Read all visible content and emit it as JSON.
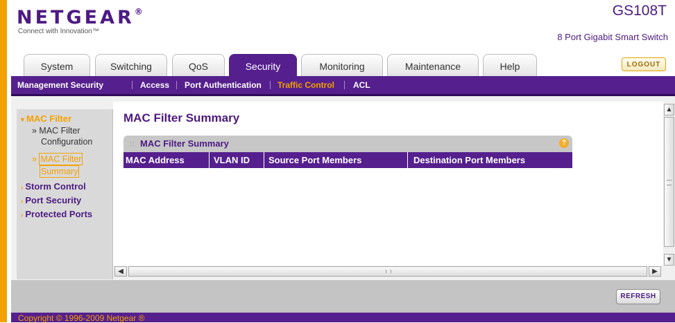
{
  "header": {
    "logo": "NETGEAR",
    "logo_mark": "®",
    "tagline": "Connect with Innovation™",
    "product": "GS108T",
    "subtitle": "8 Port Gigabit Smart Switch",
    "logout_label": "LOGOUT"
  },
  "tabs": [
    {
      "label": "System",
      "active": false
    },
    {
      "label": "Switching",
      "active": false
    },
    {
      "label": "QoS",
      "active": false
    },
    {
      "label": "Security",
      "active": true
    },
    {
      "label": "Monitoring",
      "active": false
    },
    {
      "label": "Maintenance",
      "active": false
    },
    {
      "label": "Help",
      "active": false
    }
  ],
  "subnav": [
    {
      "label": "Management Security",
      "active": false
    },
    {
      "label": "Access",
      "active": false
    },
    {
      "label": "Port Authentication",
      "active": false
    },
    {
      "label": "Traffic Control",
      "active": true
    },
    {
      "label": "ACL",
      "active": false
    }
  ],
  "sidebar": {
    "mac_filter": "MAC Filter",
    "sub1_line1": "» MAC Filter",
    "sub1_line2": "Configuration",
    "sub2_prefix": "»",
    "sub2_line1": "MAC Filter",
    "sub2_line2": "Summary",
    "storm_control": "Storm Control",
    "port_security": "Port Security",
    "protected_ports": "Protected Ports"
  },
  "main": {
    "page_title": "MAC Filter Summary",
    "table_title": "MAC Filter Summary",
    "help_glyph": "?",
    "columns": [
      "MAC Address",
      "VLAN ID",
      "Source Port Members",
      "Destination Port Members"
    ],
    "rows": []
  },
  "buttons": {
    "refresh": "REFRESH"
  },
  "footer": {
    "copyright": "Copyright © 1996-2009 Netgear ®"
  },
  "colors": {
    "brand_purple": "#55208d",
    "accent_orange": "#f5a000"
  }
}
